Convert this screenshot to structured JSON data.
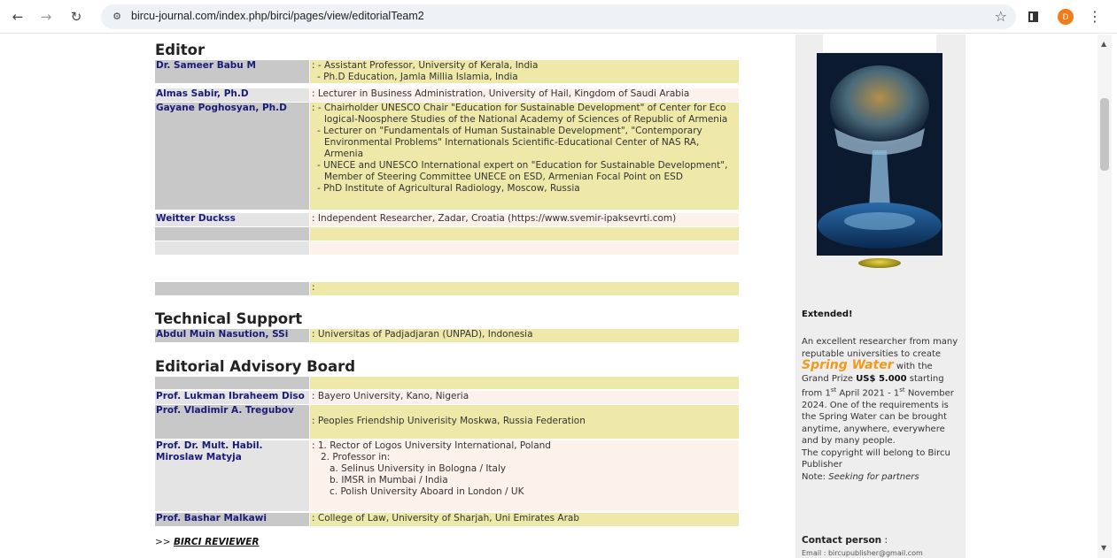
{
  "browser": {
    "url": "bircu-journal.com/index.php/birci/pages/view/editorialTeam2",
    "profile_initial": "D"
  },
  "editor": {
    "title": "Editor",
    "rows": [
      {
        "name": "Dr. Sameer Babu M",
        "lines": [
          ": - Assistant Professor, University of Kerala, India",
          "  - Ph.D Education, Jamla Millia Islamia, India"
        ]
      },
      {
        "name": "Almas Sabir, Ph.D",
        "lines": [
          ": Lecturer in Business Administration, University of Hail, Kingdom of Saudi Arabia"
        ]
      },
      {
        "name": "Gayane Poghosyan, Ph.D",
        "lines": [
          ": - Chairholder UNESCO Chair \"Education for Sustainable Development\" of Center for Eco",
          "    logical-Noosphere Studies of the National Academy of Sciences of Republic of Armenia",
          "  - Lecturer on \"Fundamentals of Human Sustainable Development\", \"Contemporary",
          "    Environmental Problems\" Internationals Scientific-Educational Center of NAS RA,",
          "    Armenia",
          "  - UNECE and UNESCO International expert on \"Education for Sustainable Development\",",
          "    Member of Steering Committee UNECE on ESD, Armenian Focal Point on ESD",
          "  - PhD Institute of Agricultural Radiology, Moscow, Russia"
        ]
      },
      {
        "name": "Weitter Duckss",
        "lines": [
          ": Independent Researcher, Zadar, Croatia (https://www.svemir-ipaksevrti.com)"
        ]
      }
    ],
    "blank_colon": ":"
  },
  "technical": {
    "title": "Technical Support",
    "name": "Abdul Muin Nasution, SSi",
    "value": ": Universitas of Padjadjaran (UNPAD), Indonesia"
  },
  "advisory": {
    "title": "Editorial Advisory Board",
    "rows": [
      {
        "name": "Prof. Lukman Ibraheem  Diso",
        "lines": [
          ": Bayero University, Kano, Nigeria"
        ]
      },
      {
        "name": "Prof. Vladimir A. Tregubov",
        "lines": [
          ": Peoples Friendship Univerisity Moskwa, Russia Federation"
        ]
      },
      {
        "name": "Prof. Dr. Mult. Habil. Miroslaw Matyja",
        "lines": [
          ":  1. Rector of Logos University International, Poland",
          "    2. Professor in:",
          "       a. Selinus University in Bologna / Italy",
          "       b. IMSR in Mumbai / India",
          "       c. Polish University Aboard in London / UK"
        ]
      },
      {
        "name": "Prof. Bashar Malkawi",
        "lines": [
          ": College of Law, University of Sharjah, Uni Emirates Arab"
        ]
      }
    ]
  },
  "reviewer": {
    "prefix": ">> ",
    "link": "BIRCI REVIEWER"
  },
  "sidebar": {
    "extended": "Extended!",
    "p1": "An excellent researcher from many reputable universities to create",
    "spring": "Spring Water",
    "p2": "with the Grand Prize",
    "prize": "US$ 5.000",
    "p3": "starting from 1",
    "sup1": "st",
    "p4": "April 2021 - 1",
    "sup2": "st",
    "p5": "November 2024. One of the requirements is the Spring Water can be brought anytime, anywhere, everywhere and by many people.",
    "p6": "The copyright will belong to Bircu Publisher",
    "note_label": "Note:",
    "note": "Seeking for partners",
    "contact_label": "Contact person",
    "contact_colon": " :",
    "email": "Email : bircupublisher@gmail.com"
  }
}
